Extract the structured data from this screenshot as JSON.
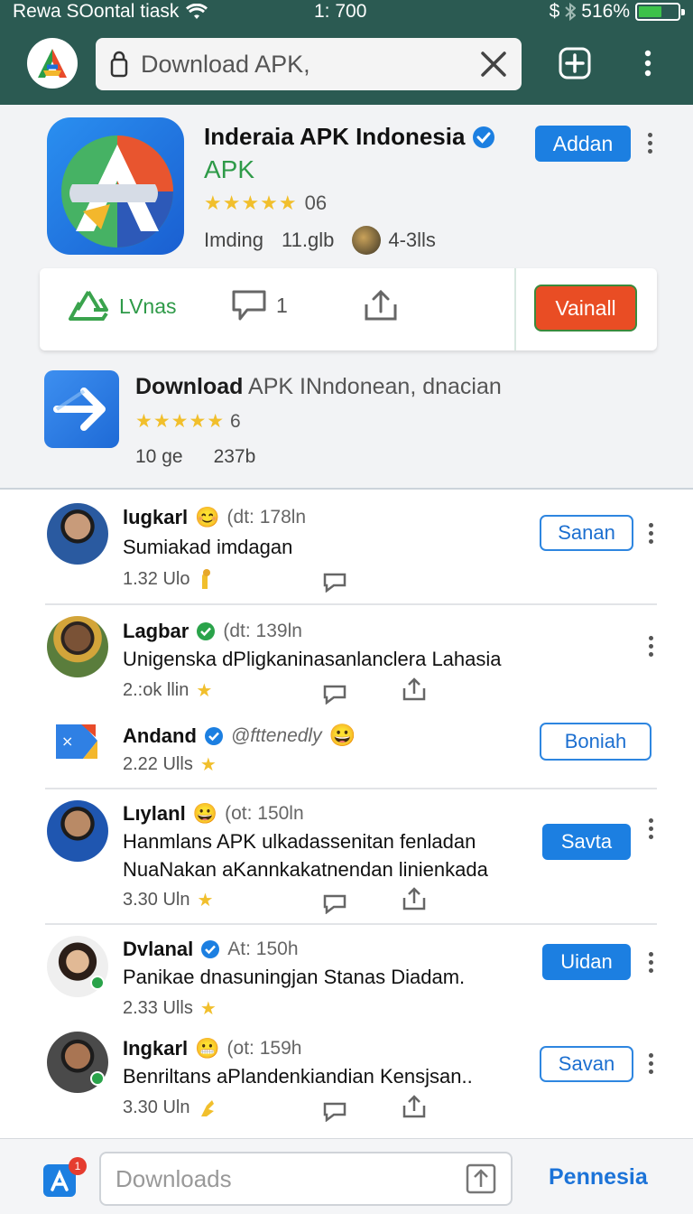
{
  "status": {
    "left": "Rewa SOontal tiask",
    "time": "1: 700",
    "battery": "516%",
    "battery_level": 0.6
  },
  "search": {
    "placeholder": "Download APK,"
  },
  "app": {
    "title": "Inderaia APK Indonesia",
    "subtitle": "APK",
    "rating_count": "06",
    "meta": {
      "label": "Imding",
      "size": "11.glb",
      "reviews": "4-3lls"
    },
    "button": "Addan",
    "actions": {
      "share_label": "LVnas",
      "comments": "1",
      "install_button": "Vainall"
    }
  },
  "second_app": {
    "title_bold": "Download",
    "title_rest": "APK INndonean, dnacian",
    "rating_count": "6",
    "meta": [
      "10 ge",
      "237b"
    ]
  },
  "posts": [
    {
      "name": "lugkarl",
      "emoji": "😊",
      "handle": "(dt: 178ln",
      "text": [
        "Sumiakad imdagan"
      ],
      "stat": "1.32 Ulo",
      "button": "Sanan",
      "button_style": "outline"
    },
    {
      "name": "Lagbar",
      "emoji": "✔",
      "handle": "(dt: 139ln",
      "text": [
        "Unigenska dPligkaninasanlanclera Lahasia"
      ],
      "stat": "2.:ok llin",
      "button": "",
      "button_style": "none"
    },
    {
      "name": "Andand",
      "emoji": "😀",
      "handle": "@fttenedly",
      "text": [],
      "stat": "2.22 Ulls",
      "button": "Boniah",
      "button_style": "outline"
    },
    {
      "name": "Lıylanl",
      "emoji": "😀",
      "handle": "(ot: 150ln",
      "text": [
        "Hanmlans APK ulkadassenitan fenladan",
        "NuaNakan aKannkakatnendan linienkada"
      ],
      "stat": "3.30 Uln",
      "button": "Savta",
      "button_style": "solid"
    },
    {
      "name": "Dvlanal",
      "emoji": "",
      "handle": "At: 150h",
      "text": [
        "Panikae dnasuningjan Stanas Diadam."
      ],
      "stat": "2.33 Ulls",
      "button": "Uidan",
      "button_style": "solid"
    },
    {
      "name": "Ingkarl",
      "emoji": "😬",
      "handle": "(ot: 159h",
      "text": [
        "Benriltans aPlandenkiandian Kensjsan.."
      ],
      "stat": "3.30 Uln",
      "button": "Savan",
      "button_style": "outline"
    }
  ],
  "bottom": {
    "downloads_placeholder": "Downloads",
    "link": "Pennesia",
    "badge": "1"
  }
}
